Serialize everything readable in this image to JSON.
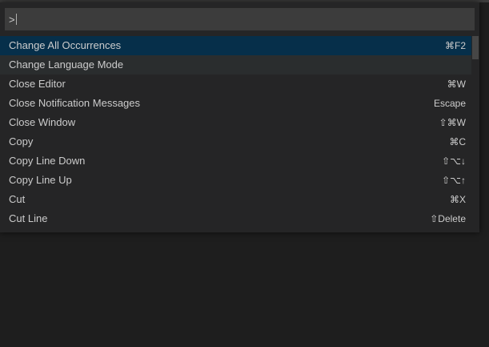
{
  "command_palette": {
    "input_value": ">",
    "items": [
      {
        "label": "Change All Occurrences",
        "keybinding": "⌘F2"
      },
      {
        "label": "Change Language Mode",
        "keybinding": ""
      },
      {
        "label": "Close Editor",
        "keybinding": "⌘W"
      },
      {
        "label": "Close Notification Messages",
        "keybinding": "Escape"
      },
      {
        "label": "Close Window",
        "keybinding": "⇧⌘W"
      },
      {
        "label": "Copy",
        "keybinding": "⌘C"
      },
      {
        "label": "Copy Line Down",
        "keybinding": "⇧⌥↓"
      },
      {
        "label": "Copy Line Up",
        "keybinding": "⇧⌥↑"
      },
      {
        "label": "Cut",
        "keybinding": "⌘X"
      },
      {
        "label": "Cut Line",
        "keybinding": "⇧Delete"
      }
    ],
    "selected_index": 0,
    "hover_index": 1,
    "scrollbar_position": 0
  },
  "colors": {
    "background": "#1e1e1e",
    "palette_bg": "#252526",
    "input_bg": "#3c3c3c",
    "selected_bg": "#062f4a",
    "hover_bg": "#2a2d2e",
    "text": "#cccccc"
  }
}
